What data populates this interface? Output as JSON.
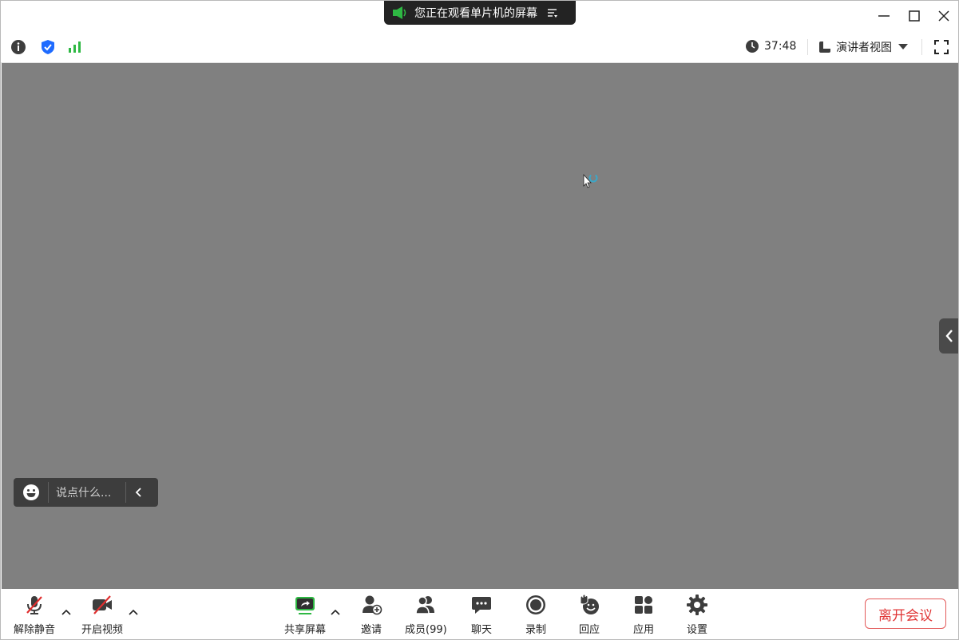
{
  "banner": {
    "text": "您正在观看单片机的屏幕"
  },
  "infobar": {
    "timer": "37:48",
    "view_label": "演讲者视图"
  },
  "chat": {
    "placeholder": "说点什么..."
  },
  "toolbar": {
    "unmute": "解除静音",
    "video": "开启视频",
    "share": "共享屏幕",
    "invite": "邀请",
    "members": "成员(99)",
    "chat": "聊天",
    "record": "录制",
    "react": "回应",
    "apps": "应用",
    "settings": "设置",
    "leave": "离开会议"
  },
  "colors": {
    "accent": "#2eb843",
    "stage": "#808080",
    "leave": "#e03535"
  }
}
